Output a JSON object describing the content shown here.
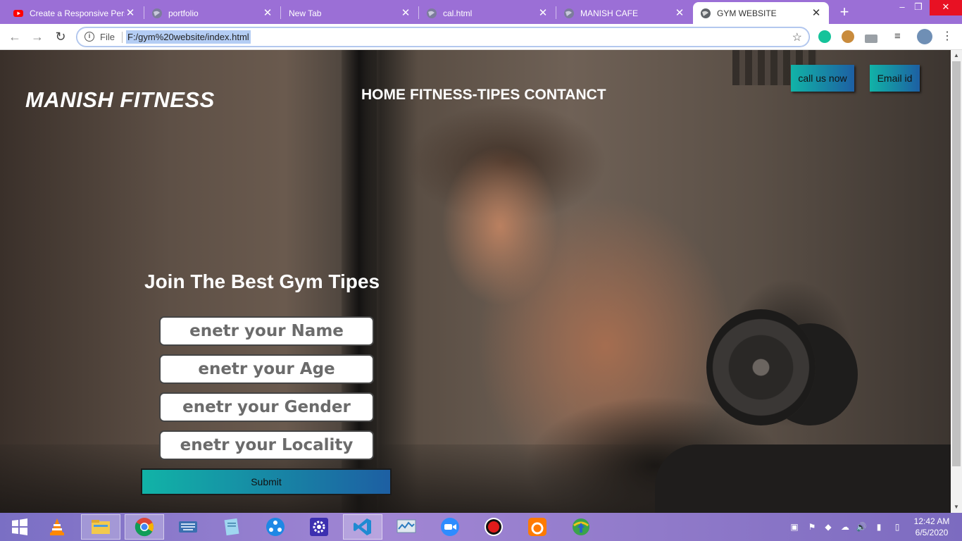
{
  "browser": {
    "tabs": [
      {
        "title": "Create a Responsive Pers",
        "icon": "youtube-icon"
      },
      {
        "title": "portfolio",
        "icon": "globe-icon"
      },
      {
        "title": "New Tab",
        "icon": ""
      },
      {
        "title": "cal.html",
        "icon": "globe-icon"
      },
      {
        "title": "MANISH CAFE",
        "icon": "globe-icon"
      },
      {
        "title": "GYM WEBSITE",
        "icon": "globe-icon",
        "active": true
      }
    ],
    "omnibox": {
      "scheme_label": "File",
      "url": "F:/gym%20website/index.html"
    }
  },
  "site": {
    "logo": "MANISH FITNESS",
    "nav": [
      "HOME",
      "FITNESS-TIPES",
      "CONTANCT"
    ],
    "call_button": "call us now",
    "email_button": "Email id",
    "form": {
      "heading": "Join The Best Gym Tipes",
      "name_placeholder": "enetr your Name",
      "age_placeholder": "enetr your Age",
      "gender_placeholder": "enetr your Gender",
      "locality_placeholder": "enetr your Locality",
      "submit": "Submit"
    },
    "accent_colors": [
      "#11b3a7",
      "#1d5fa3"
    ]
  },
  "taskbar": {
    "time": "12:42 AM",
    "date": "6/5/2020",
    "apps": [
      "windows-start-icon",
      "vlc-icon",
      "file-explorer-icon",
      "chrome-icon",
      "keyboard-icon",
      "notepad-icon",
      "share-icon",
      "settings-icon",
      "vscode-icon",
      "task-manager-icon",
      "zoom-icon",
      "record-icon",
      "uc-browser-icon",
      "internet-download-manager-icon"
    ]
  }
}
